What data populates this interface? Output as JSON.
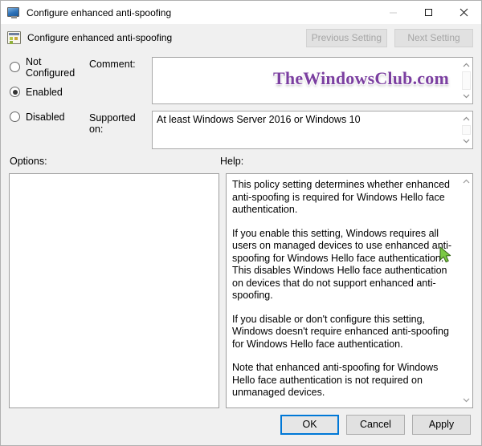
{
  "window": {
    "title": "Configure enhanced anti-spoofing",
    "controls": {
      "minimize": "Minimize",
      "maximize": "Maximize",
      "close": "Close"
    }
  },
  "header": {
    "title": "Configure enhanced anti-spoofing",
    "previous_setting": "Previous Setting",
    "next_setting": "Next Setting"
  },
  "state": {
    "options": [
      {
        "label": "Not Configured",
        "selected": false
      },
      {
        "label": "Enabled",
        "selected": true
      },
      {
        "label": "Disabled",
        "selected": false
      }
    ]
  },
  "comment": {
    "label": "Comment:",
    "value": "",
    "watermark": "TheWindowsClub.com",
    "watermark_color": "#7b3fa0"
  },
  "supported": {
    "label": "Supported on:",
    "value": "At least Windows Server 2016 or Windows 10"
  },
  "sections": {
    "options_label": "Options:",
    "help_label": "Help:"
  },
  "options_pane": {
    "content": ""
  },
  "help": {
    "paragraphs": [
      "This policy setting determines whether enhanced anti-spoofing is required for Windows Hello face authentication.",
      "If you enable this setting, Windows requires all users on managed devices to use enhanced anti-spoofing for Windows Hello face authentication. This disables Windows Hello face authentication on devices that do not support enhanced anti-spoofing.",
      "If you disable or don't configure this setting, Windows doesn't require enhanced anti-spoofing for Windows Hello face authentication.",
      "Note that enhanced anti-spoofing for Windows Hello face authentication is not required on unmanaged devices."
    ]
  },
  "footer": {
    "ok": "OK",
    "cancel": "Cancel",
    "apply": "Apply"
  },
  "accent": {
    "focus_border": "#0078d7"
  }
}
